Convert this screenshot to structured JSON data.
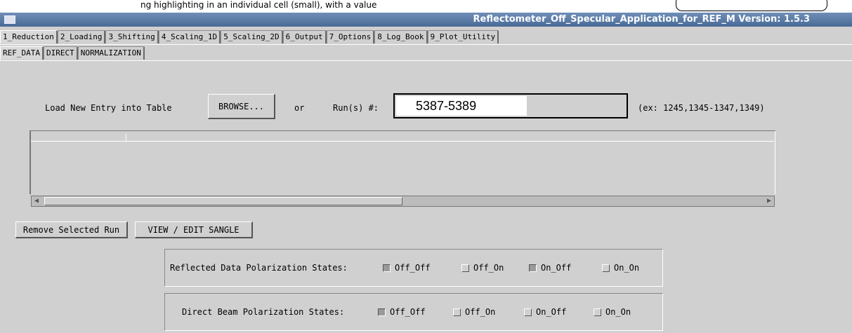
{
  "window": {
    "title": "Reflectometer_Off_Specular_Application_for_REF_M Version: 1.5.3"
  },
  "banner": {
    "text": "ng highlighting in an individual cell (small), with a value "
  },
  "main_tabs": [
    {
      "label": "1_Reduction",
      "active": true
    },
    {
      "label": "2_Loading",
      "active": false
    },
    {
      "label": "3_Shifting",
      "active": false
    },
    {
      "label": "4_Scaling_1D",
      "active": false
    },
    {
      "label": "5_Scaling_2D",
      "active": false
    },
    {
      "label": "6_Output",
      "active": false
    },
    {
      "label": "7_Options",
      "active": false
    },
    {
      "label": "8_Log_Book",
      "active": false
    },
    {
      "label": "9_Plot_Utility",
      "active": false
    }
  ],
  "sub_tabs": [
    {
      "label": "REF_DATA",
      "active": true
    },
    {
      "label": "DIRECT",
      "active": false
    },
    {
      "label": "NORMALIZATION",
      "active": false
    }
  ],
  "load": {
    "label": "Load New Entry into Table",
    "browse_label": "BROWSE...",
    "or_label": "or",
    "runs_label": "Run(s) #:",
    "runs_value": "5387-5389",
    "example": "(ex: 1245,1345-1347,1349)"
  },
  "actions": {
    "remove_label": "Remove Selected Run",
    "view_edit_label": "VIEW / EDIT SANGLE"
  },
  "reflected": {
    "label": "Reflected Data Polarization States:",
    "states": [
      {
        "label": "Off_Off",
        "checked": true
      },
      {
        "label": "Off_On",
        "checked": false
      },
      {
        "label": "On_Off",
        "checked": true
      },
      {
        "label": "On_On",
        "checked": false
      }
    ]
  },
  "direct": {
    "label": "Direct Beam Polarization States:",
    "states": [
      {
        "label": "Off_Off",
        "checked": true
      },
      {
        "label": "Off_On",
        "checked": false
      },
      {
        "label": "On_Off",
        "checked": false
      },
      {
        "label": "On_On",
        "checked": false
      }
    ]
  },
  "scroll": {
    "position": 0.0,
    "thumb_fraction": 0.48
  }
}
